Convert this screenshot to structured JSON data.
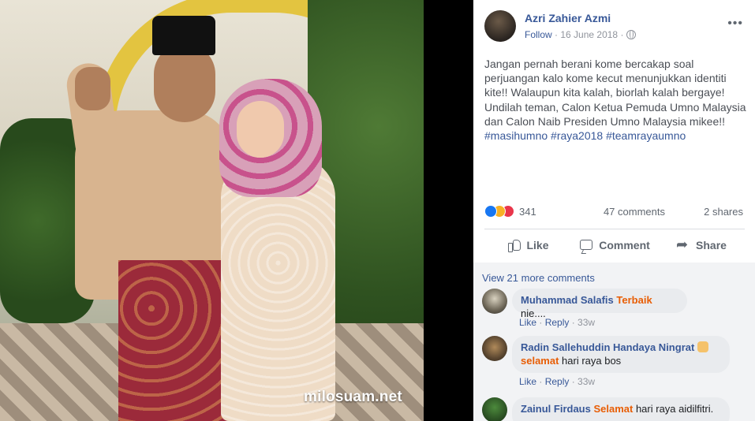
{
  "photo": {
    "watermark": "milosuam.net"
  },
  "post": {
    "author": "Azri Zahier Azmi",
    "follow": "Follow",
    "separator": "·",
    "date": "16 June 2018",
    "more": "•••",
    "text": "Jangan pernah berani kome bercakap soal perjuangan kalo kome kecut menunjukkan identiti kite!! Walaupun kita kalah, biorlah kalah bergaye! Undilah teman, Calon Ketua Pemuda Umno Malaysia dan Calon Naib Presiden Umno Malaysia mikee!! ",
    "hashtags": "#masihumno #raya2018 #teamrayaumno",
    "reaction_count": "341",
    "comments_count": "47 comments",
    "shares_count": "2 shares",
    "actions": {
      "like": "Like",
      "comment": "Comment",
      "share": "Share"
    }
  },
  "comments": {
    "view_more": "View 21 more comments",
    "list": [
      {
        "name": "Muhammad Salafis",
        "tag": "Terbaik",
        "text": " nie....",
        "like": "Like",
        "reply": "Reply",
        "time": "33w"
      },
      {
        "name": "Radin Sallehuddin Handaya Ningrat",
        "tag": "selamat",
        "text": " hari raya bos",
        "like": "Like",
        "reply": "Reply",
        "time": "33w"
      },
      {
        "name": "Zainul Firdaus",
        "tag": "Selamat",
        "text": " hari raya aidilfitri."
      }
    ]
  },
  "colors": {
    "link": "#385898",
    "tag": "#e85d04",
    "like": "#1877f2",
    "love": "#e9364b",
    "haha": "#f7b125"
  },
  "icons": [
    "globe-icon",
    "more-icon",
    "like-icon",
    "comment-icon",
    "share-icon",
    "like-reaction-icon",
    "haha-reaction-icon",
    "love-reaction-icon",
    "clap-emoji-icon"
  ]
}
